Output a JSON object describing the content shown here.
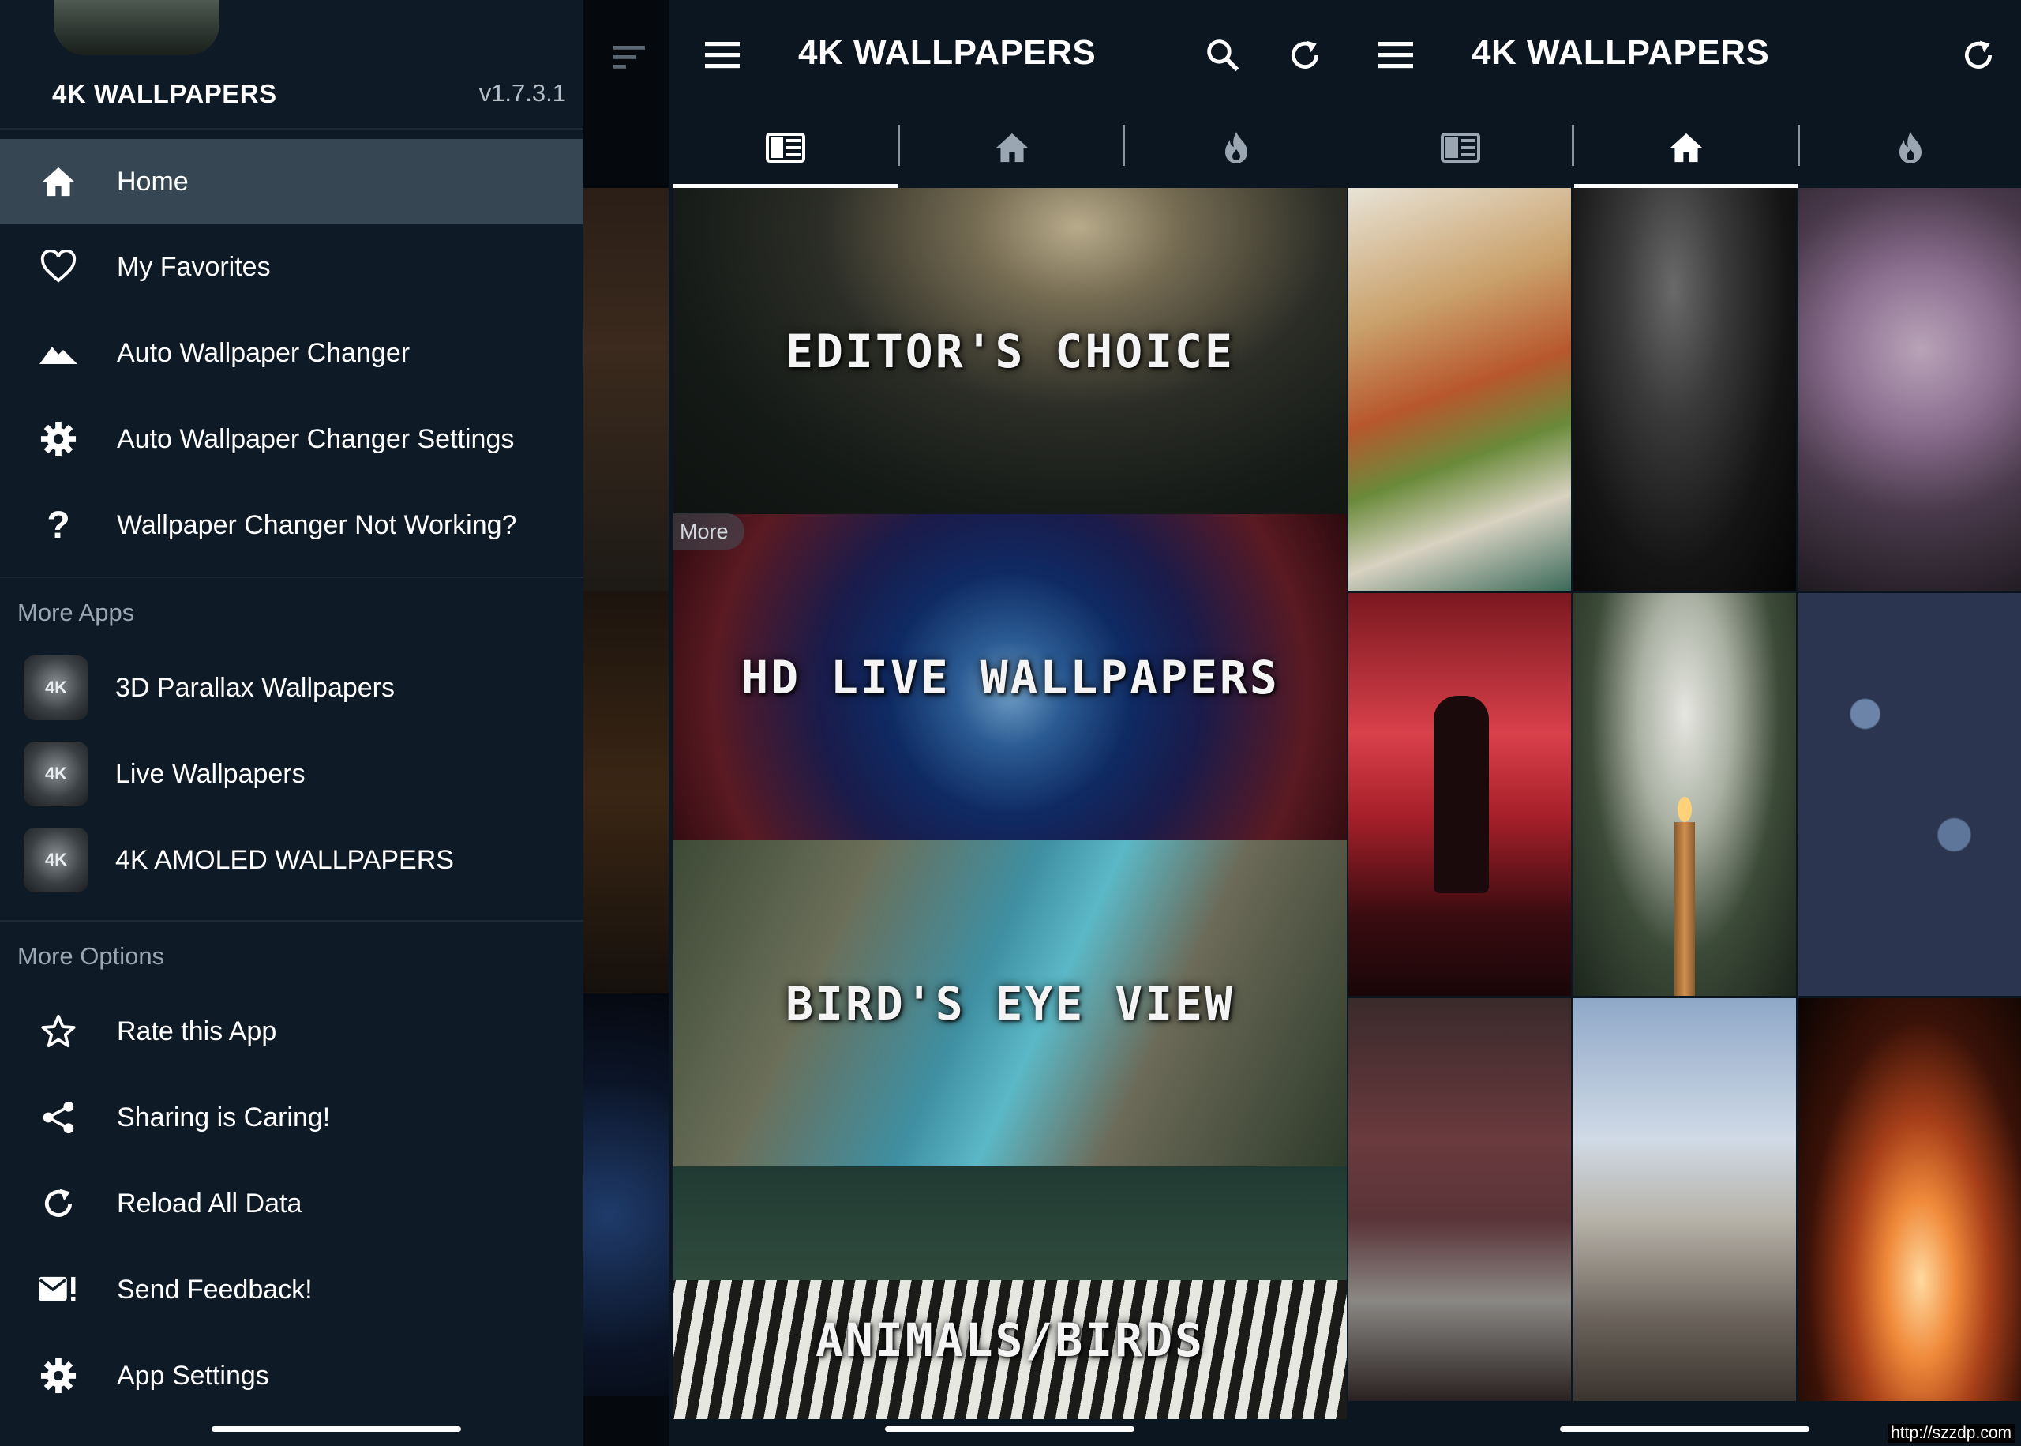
{
  "drawer": {
    "app_title": "4K WALLPAPERS",
    "version": "v1.7.3.1",
    "menu": [
      {
        "label": "Home",
        "icon": "home-icon",
        "active": true
      },
      {
        "label": "My Favorites",
        "icon": "heart-icon"
      },
      {
        "label": "Auto Wallpaper Changer",
        "icon": "mountain-icon"
      },
      {
        "label": "Auto Wallpaper Changer Settings",
        "icon": "gear-icon"
      },
      {
        "label": "Wallpaper Changer Not Working?",
        "icon": "question-icon"
      }
    ],
    "more_apps_title": "More Apps",
    "more_apps": [
      {
        "label": "3D Parallax Wallpapers",
        "thumb_text": "4K"
      },
      {
        "label": "Live Wallpapers",
        "thumb_text": "4K"
      },
      {
        "label": "4K AMOLED WALLPAPERS",
        "thumb_text": "4K"
      }
    ],
    "more_options_title": "More Options",
    "more_options": [
      {
        "label": "Rate this App",
        "icon": "star-icon"
      },
      {
        "label": "Sharing is Caring!",
        "icon": "share-icon"
      },
      {
        "label": "Reload All Data",
        "icon": "reload-icon"
      },
      {
        "label": "Send Feedback!",
        "icon": "mail-alert-icon"
      },
      {
        "label": "App Settings",
        "icon": "gear-icon"
      }
    ]
  },
  "categories_screen": {
    "title": "4K WALLPAPERS",
    "tabs": [
      "categories-icon",
      "home-icon",
      "fire-icon"
    ],
    "active_tab": 0,
    "more_label": "More",
    "categories": [
      {
        "label": "EDITOR'S CHOICE"
      },
      {
        "label": "HD LIVE WALLPAPERS"
      },
      {
        "label": "BIRD'S EYE VIEW"
      },
      {
        "label": "ANIMALS/BIRDS"
      }
    ]
  },
  "grid_screen": {
    "title": "4K WALLPAPERS",
    "tabs": [
      "categories-icon",
      "home-icon",
      "fire-icon"
    ],
    "active_tab": 1,
    "thumbnails": [
      "hot dogs",
      "black smoke",
      "purple hydrangea",
      "silhouette at red sunset",
      "candle with pine branches",
      "blue plums",
      "forest road",
      "person on misty hill",
      "fire sparks"
    ]
  },
  "watermark": "http://szzdp.com",
  "colors": {
    "background": "#0c1620",
    "drawer": "#0e1b26",
    "active_item": "#364652",
    "section_title": "#9aa6b1"
  }
}
